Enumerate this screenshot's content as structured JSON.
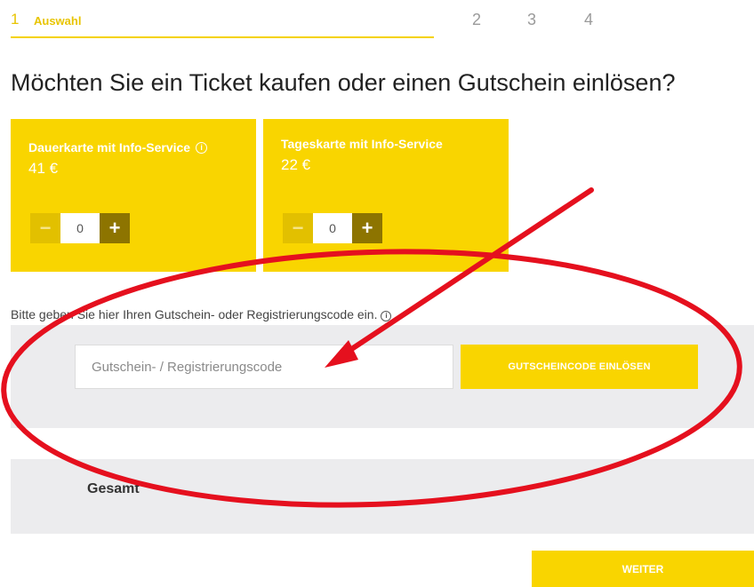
{
  "stepper": {
    "active_number": "1",
    "active_label": "Auswahl",
    "step2": "2",
    "step3": "3",
    "step4": "4"
  },
  "page_title": "Möchten Sie ein Ticket kaufen oder einen Gutschein einlösen?",
  "tickets": [
    {
      "name": "Dauerkarte mit Info-Service",
      "info_icon": "info-icon",
      "price": "41 €",
      "quantity": "0",
      "minus": "−",
      "plus": "+"
    },
    {
      "name": "Tageskarte mit Info-Service",
      "price": "22 €",
      "quantity": "0",
      "minus": "−",
      "plus": "+"
    }
  ],
  "voucher": {
    "label": "Bitte geben Sie hier Ihren Gutschein- oder Registrierungscode ein.",
    "placeholder": "Gutschein- / Registrierungscode",
    "value": "",
    "button_label": "GUTSCHEINCODE EINLÖSEN"
  },
  "total": {
    "label": "Gesamt"
  },
  "next_label": "WEITER",
  "info_glyph": "i",
  "colors": {
    "accent": "#f9d500",
    "plus_button": "#8d7400",
    "panel": "#ececee",
    "annotation": "#e5101e"
  }
}
